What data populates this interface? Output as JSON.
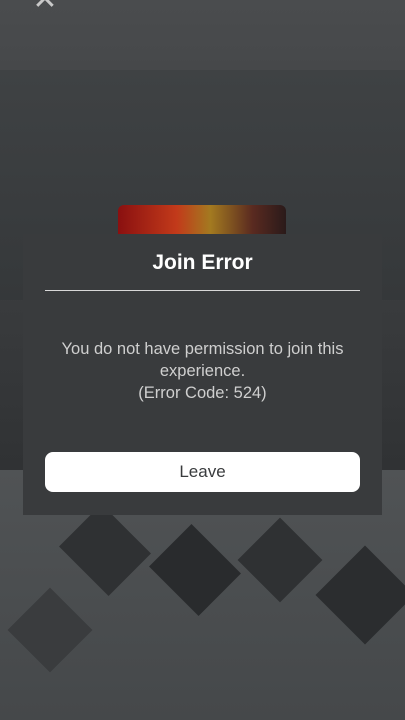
{
  "dialog": {
    "title": "Join Error",
    "message_line1": "You do not have permission to join this",
    "message_line2": "experience.",
    "error_code": "(Error Code: 524)",
    "leave_label": "Leave"
  },
  "icons": {
    "close": "close-icon"
  },
  "colors": {
    "dialog_bg": "#393b3d",
    "button_bg": "#ffffff",
    "title_text": "#ffffff",
    "message_text": "#cfcfcf"
  }
}
